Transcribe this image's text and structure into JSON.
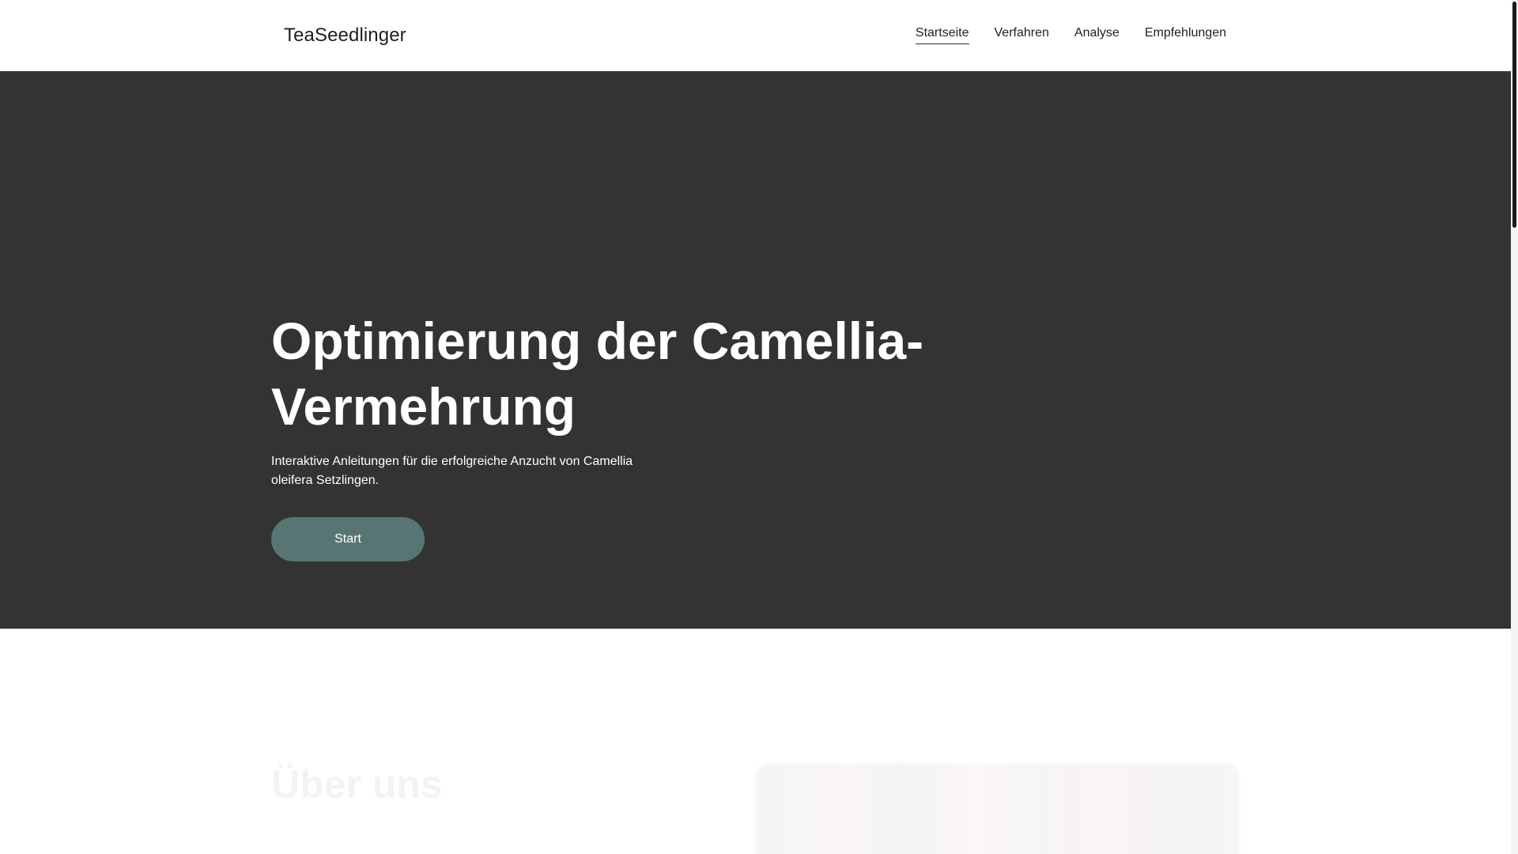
{
  "header": {
    "brand": "TeaSeedlinger",
    "nav": [
      {
        "label": "Startseite",
        "active": true
      },
      {
        "label": "Verfahren",
        "active": false
      },
      {
        "label": "Analyse",
        "active": false
      },
      {
        "label": "Empfehlungen",
        "active": false
      }
    ]
  },
  "hero": {
    "title": "Optimierung der Camellia-Vermehrung",
    "subtitle": "Interaktive Anleitungen für die erfolgreiche Anzucht von Camellia oleifera Setzlingen.",
    "button_label": "Start",
    "background_color": "#333333",
    "button_color": "#577673"
  },
  "about": {
    "title": "Über uns"
  }
}
